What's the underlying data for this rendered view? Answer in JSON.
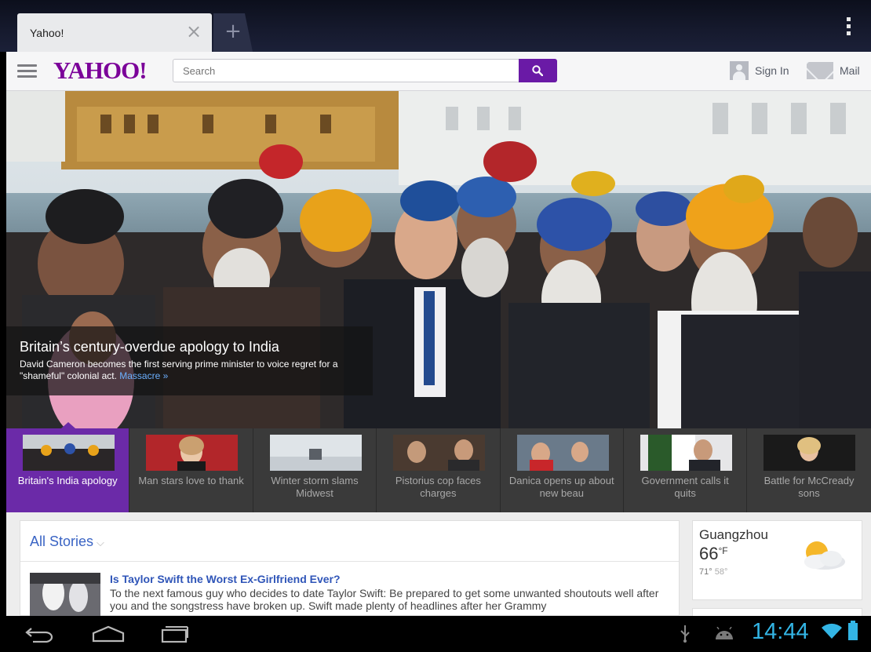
{
  "browser": {
    "tab_title": "Yahoo!",
    "close_tab_glyph": "×",
    "new_tab_glyph": "+",
    "icons": {
      "close": "close-icon",
      "new_tab": "plus-icon",
      "menu": "overflow-menu-icon"
    }
  },
  "header": {
    "logo_text": "YAHOO!",
    "search_placeholder": "Search",
    "sign_in": "Sign In",
    "mail": "Mail",
    "colors": {
      "brand": "#7b0099",
      "search_button": "#6a1aa6"
    }
  },
  "hero": {
    "headline": "Britain’s century-overdue apology to India",
    "summary": "David Cameron becomes the first serving prime minister to voice regret for a \"shameful\" colonial act.",
    "link_text": "Massacre »"
  },
  "carousel": [
    {
      "label": "Britain's India apology",
      "active": true
    },
    {
      "label": "Man stars love to thank",
      "active": false
    },
    {
      "label": "Winter storm slams Midwest",
      "active": false
    },
    {
      "label": "Pistorius cop faces charges",
      "active": false
    },
    {
      "label": "Danica opens up about new beau",
      "active": false
    },
    {
      "label": "Government calls it quits",
      "active": false
    },
    {
      "label": "Battle for McCready sons",
      "active": false
    }
  ],
  "stories": {
    "heading": "All Stories",
    "heading_chevron": "⌵",
    "items": [
      {
        "title": "Is Taylor Swift the Worst Ex-Girlfriend Ever?",
        "snippet": "To the next famous guy who decides to date Taylor Swift: Be prepared to get some unwanted shoutouts well after you and the songstress have broken up. Swift made plenty of headlines after her Grammy"
      }
    ]
  },
  "weather": {
    "city": "Guangzhou",
    "temp": "66",
    "unit": "°F",
    "high": "71°",
    "low": "58°",
    "icon": "partly-cloudy-icon"
  },
  "system_bar": {
    "time": "14:44",
    "accent": "#33b5e5",
    "icons": [
      "back-icon",
      "home-icon",
      "recents-icon",
      "usb-icon",
      "android-icon",
      "wifi-icon",
      "battery-icon"
    ]
  }
}
